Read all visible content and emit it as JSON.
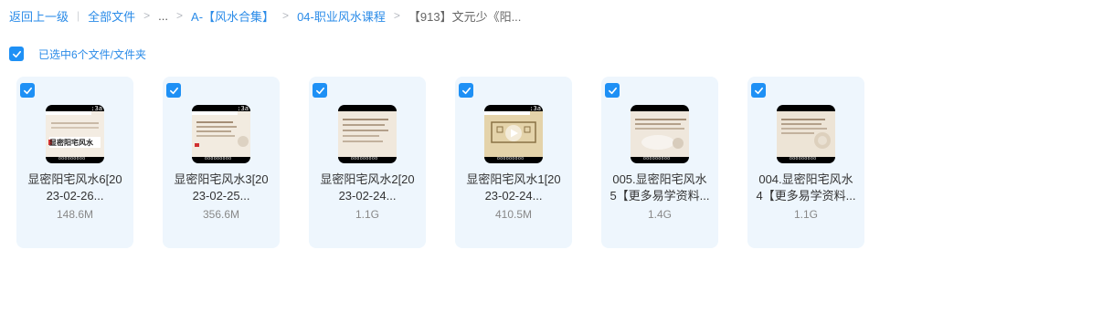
{
  "breadcrumb": {
    "back": "返回上一级",
    "separator": "|",
    "chevron": ">",
    "items": [
      "全部文件",
      "...",
      "A-【风水合集】",
      "04-职业风水课程",
      "【913】文元少《阳..."
    ]
  },
  "selection": {
    "label": "已选中6个文件/文件夹",
    "checked": true
  },
  "colors": {
    "accent": "#1e90f5",
    "link": "#2a8be8",
    "card_bg": "#eef6fd"
  },
  "files": [
    {
      "name_line1": "显密阳宅风水6[20",
      "name_line2": "23-02-26...",
      "size": "148.6M",
      "thumb_tag": ":3a",
      "thumb_caption": "显密阳宅风水",
      "thumb_footer": "ooooooooo",
      "checked": true
    },
    {
      "name_line1": "显密阳宅风水3[20",
      "name_line2": "23-02-25...",
      "size": "356.6M",
      "thumb_tag": ":3a",
      "thumb_footer": "ooooooooo",
      "checked": true
    },
    {
      "name_line1": "显密阳宅风水2[20",
      "name_line2": "23-02-24...",
      "size": "1.1G",
      "thumb_tag": "",
      "thumb_footer": "ooooooooo",
      "checked": true
    },
    {
      "name_line1": "显密阳宅风水1[20",
      "name_line2": "23-02-24...",
      "size": "410.5M",
      "thumb_tag": ":3a",
      "thumb_footer": "ooooooooo",
      "checked": true
    },
    {
      "name_line1": "005.显密阳宅风水",
      "name_line2": "5【更多易学资料...",
      "size": "1.4G",
      "thumb_tag": "",
      "thumb_footer": "ooooooooo",
      "checked": true
    },
    {
      "name_line1": "004.显密阳宅风水",
      "name_line2": "4【更多易学资料...",
      "size": "1.1G",
      "thumb_tag": "",
      "thumb_footer": "ooooooooo",
      "checked": true
    }
  ]
}
